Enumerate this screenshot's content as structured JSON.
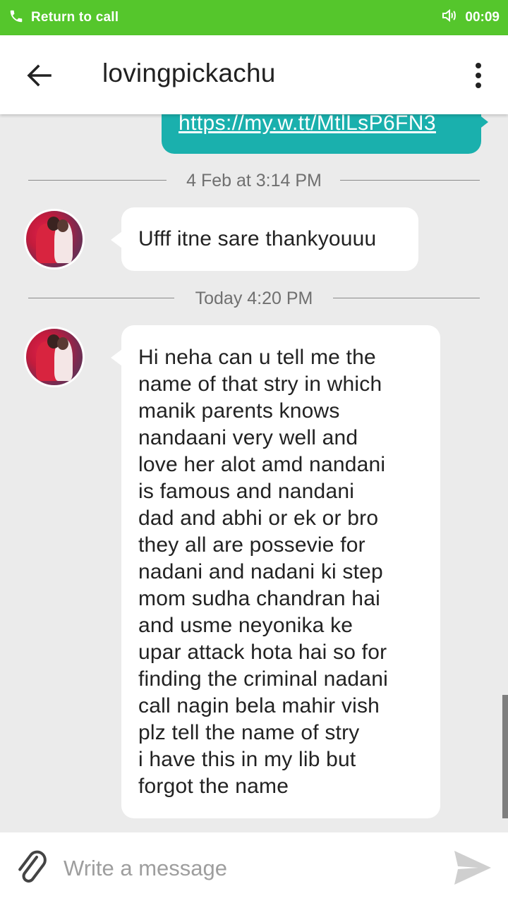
{
  "call_bar": {
    "label": "Return to call",
    "timer": "00:09"
  },
  "app_bar": {
    "title": "lovingpickachu"
  },
  "conversation": {
    "sent_link": "https://my.w.tt/MtlLsP6FN3",
    "dividers": [
      "4 Feb at 3:14 PM",
      "Today 4:20 PM"
    ],
    "messages": [
      {
        "lines": [
          "Ufff itne sare thankyouuu"
        ]
      },
      {
        "lines": [
          "Hi neha can u tell me the",
          "name of that stry in which",
          "manik parents knows",
          "nandaani very well and",
          "love her alot amd nandani",
          "is famous and nandani",
          "dad and abhi or ek or bro",
          "they all are possevie for",
          "nadani and nadani ki step",
          "mom sudha chandran hai",
          "and usme neyonika ke",
          "upar attack hota hai so for",
          "finding the criminal nadani",
          "call nagin bela mahir vish",
          "plz tell the name of stry",
          "i have this in my lib but",
          "forgot the name"
        ]
      }
    ]
  },
  "composer": {
    "placeholder": "Write a message"
  },
  "colors": {
    "call_bar": "#55c62c",
    "sent_bubble": "#1ab0ad",
    "background": "#ebebeb"
  },
  "icons": [
    "phone-icon",
    "speaker-icon",
    "back-arrow-icon",
    "more-vert-icon",
    "paperclip-icon",
    "send-icon"
  ]
}
